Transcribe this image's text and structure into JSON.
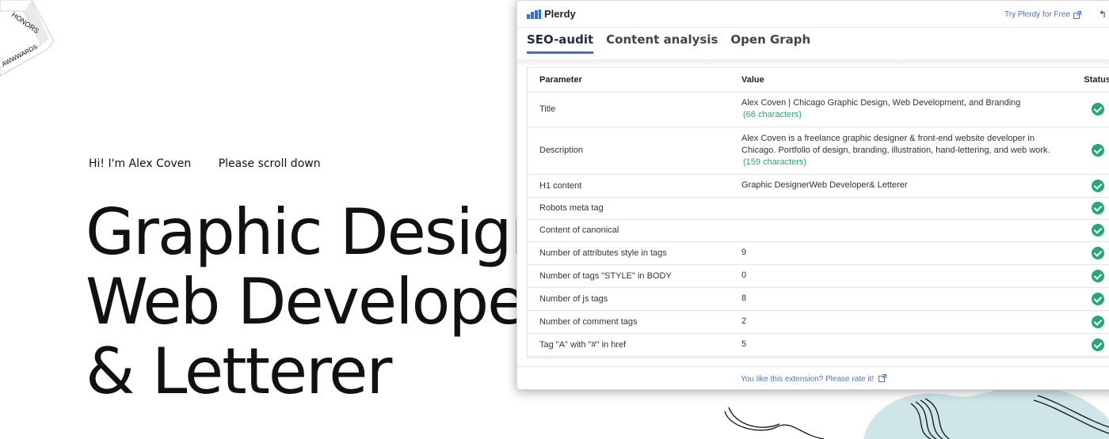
{
  "site": {
    "ribbon_top": "HONORS",
    "ribbon_bottom": "AWWWARDS",
    "intro_name": "Hi! I'm Alex Coven",
    "intro_scroll": "Please scroll down",
    "hero_lines": [
      "Graphic Designer",
      "Web Developer",
      "& Letterer"
    ]
  },
  "panel": {
    "brand": "Plerdy",
    "try_link": "Try Plerdy for Free",
    "tabs": [
      "SEO-audit",
      "Content analysis",
      "Open Graph"
    ],
    "active_tab": "SEO-audit",
    "table": {
      "headers": {
        "parameter": "Parameter",
        "value": "Value",
        "status": "Status"
      },
      "rows": [
        {
          "parameter": "Title",
          "value": "Alex Coven | Chicago Graphic Design, Web Development, and Branding",
          "note": "(66 characters)",
          "status": "ok"
        },
        {
          "parameter": "Description",
          "value": "Alex Coven is a freelance graphic designer & front-end website developer in Chicago. Portfolio of design, branding, illustration, hand-lettering, and web work.",
          "note": "(159 characters)",
          "status": "ok"
        },
        {
          "parameter": "H1 content",
          "value": "Graphic DesignerWeb Developer& Letterer",
          "note": "",
          "status": "ok"
        },
        {
          "parameter": "Robots meta tag",
          "value": "",
          "note": "",
          "status": "ok"
        },
        {
          "parameter": "Content of canonical",
          "value": "",
          "note": "",
          "status": "ok"
        },
        {
          "parameter": "Number of attributes style in tags",
          "value": "9",
          "note": "",
          "status": "ok"
        },
        {
          "parameter": "Number of tags \"STYLE\" in BODY",
          "value": "0",
          "note": "",
          "status": "ok"
        },
        {
          "parameter": "Number of js tags",
          "value": "8",
          "note": "",
          "status": "ok"
        },
        {
          "parameter": "Number of comment tags",
          "value": "2",
          "note": "",
          "status": "ok"
        },
        {
          "parameter": "Tag \"A\" with \"#\" in href",
          "value": "5",
          "note": "",
          "status": "ok"
        }
      ]
    },
    "footer": "You like this extension? Please rate it!"
  },
  "colors": {
    "accent": "#3a6fd8",
    "status_ok": "#23a87a",
    "link": "#4a74c9",
    "doodle_fill": "#cfe6e8"
  }
}
